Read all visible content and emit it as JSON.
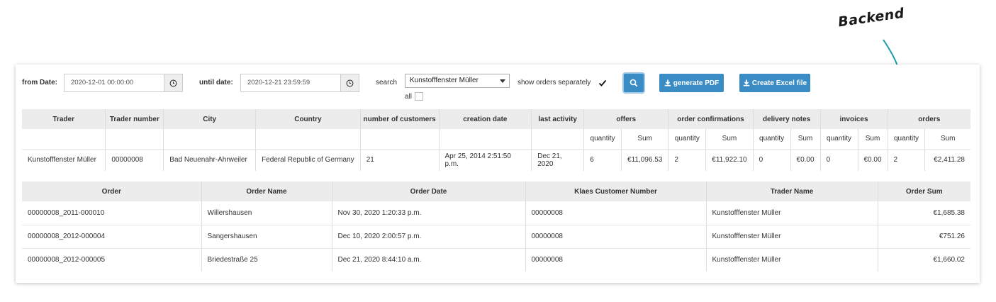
{
  "annotation": "Backend",
  "filters": {
    "from_label": "from Date:",
    "from_value": "2020-12-01 00:00:00",
    "until_label": "until date:",
    "until_value": "2020-12-21 23:59:59",
    "search_label": "search",
    "search_value": "Kunstofffenster Müller",
    "all_label": "all",
    "separate_label": "show orders separately",
    "separate_checked": true
  },
  "buttons": {
    "pdf_label": "generate PDF",
    "excel_label": "Create Excel file"
  },
  "summary": {
    "headers": [
      "Trader",
      "Trader number",
      "City",
      "Country",
      "number of customers",
      "creation date",
      "last activity",
      "offers",
      "order confirmations",
      "delivery notes",
      "invoices",
      "orders"
    ],
    "sub_headers": [
      "quantity",
      "Sum"
    ],
    "row": {
      "trader": "Kunstofffenster Müller",
      "trader_number": "00000008",
      "city": "Bad Neuenahr-Ahrweiler",
      "country": "Federal Republic of Germany",
      "customers": "21",
      "creation_date": "Apr 25, 2014 2:51:50 p.m.",
      "last_activity": "Dec 21, 2020",
      "offers_qty": "6",
      "offers_sum": "€11,096.53",
      "confirmations_qty": "2",
      "confirmations_sum": "€11,922.10",
      "delivery_qty": "0",
      "delivery_sum": "€0.00",
      "invoices_qty": "0",
      "invoices_sum": "€0.00",
      "orders_qty": "2",
      "orders_sum": "€2,411.28"
    }
  },
  "orders": {
    "headers": [
      "Order",
      "Order Name",
      "Order Date",
      "Klaes Customer Number",
      "Trader Name",
      "Order Sum"
    ],
    "rows": [
      [
        "00000008_2011-000010",
        "Willershausen",
        "Nov 30, 2020 1:20:33 p.m.",
        "00000008",
        "Kunstofffenster Müller",
        "€1,685.38"
      ],
      [
        "00000008_2012-000004",
        "Sangershausen",
        "Dec 10, 2020 2:00:57 p.m.",
        "00000008",
        "Kunstofffenster Müller",
        "€751.26"
      ],
      [
        "00000008_2012-000005",
        "Briedestraße 25",
        "Dec 21, 2020 8:44:10 a.m.",
        "00000008",
        "Kunstofffenster Müller",
        "€1,660.02"
      ]
    ]
  }
}
